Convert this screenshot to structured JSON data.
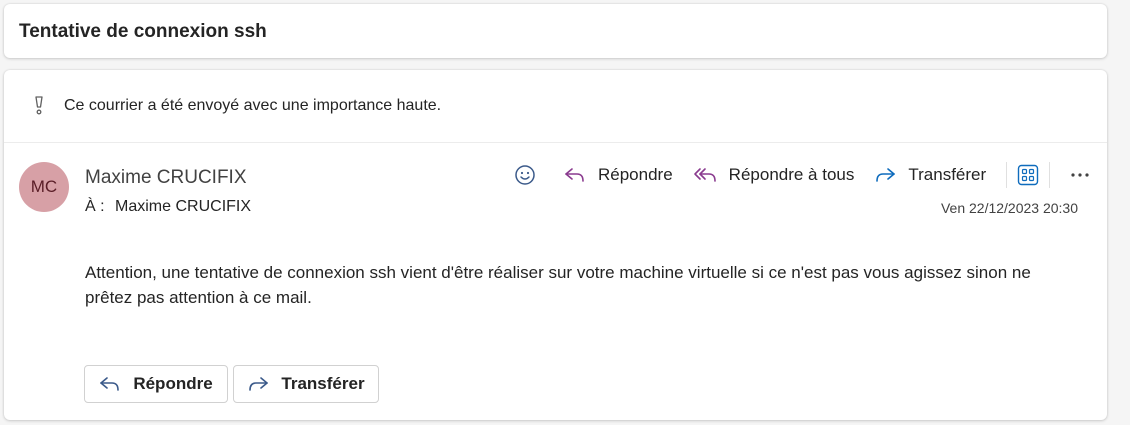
{
  "subject": "Tentative de connexion ssh",
  "importance": {
    "text": "Ce courrier a été envoyé avec une importance haute.",
    "icon": "exclamation-icon"
  },
  "message": {
    "avatar_initials": "MC",
    "avatar_color": "#d7a0a6",
    "sender": "Maxime CRUCIFIX",
    "to_label": "À :",
    "to_value": "Maxime CRUCIFIX",
    "date": "Ven 22/12/2023 20:30",
    "body": "Attention, une tentative de connexion ssh vient d'être réaliser sur votre machine virtuelle si ce n'est pas vous agissez sinon ne prêtez pas attention à ce mail."
  },
  "toolbar": {
    "emoji_icon": "smiley-icon",
    "reply_label": "Répondre",
    "reply_all_label": "Répondre à tous",
    "forward_label": "Transférer",
    "apps_icon": "apps-icon",
    "more_icon": "more-icon"
  },
  "footer": {
    "reply_label": "Répondre",
    "forward_label": "Transférer"
  },
  "colors": {
    "reply_all_accent": "#8a3b8f",
    "forward_accent": "#0f6cbd",
    "apps_accent": "#0f6cbd"
  }
}
